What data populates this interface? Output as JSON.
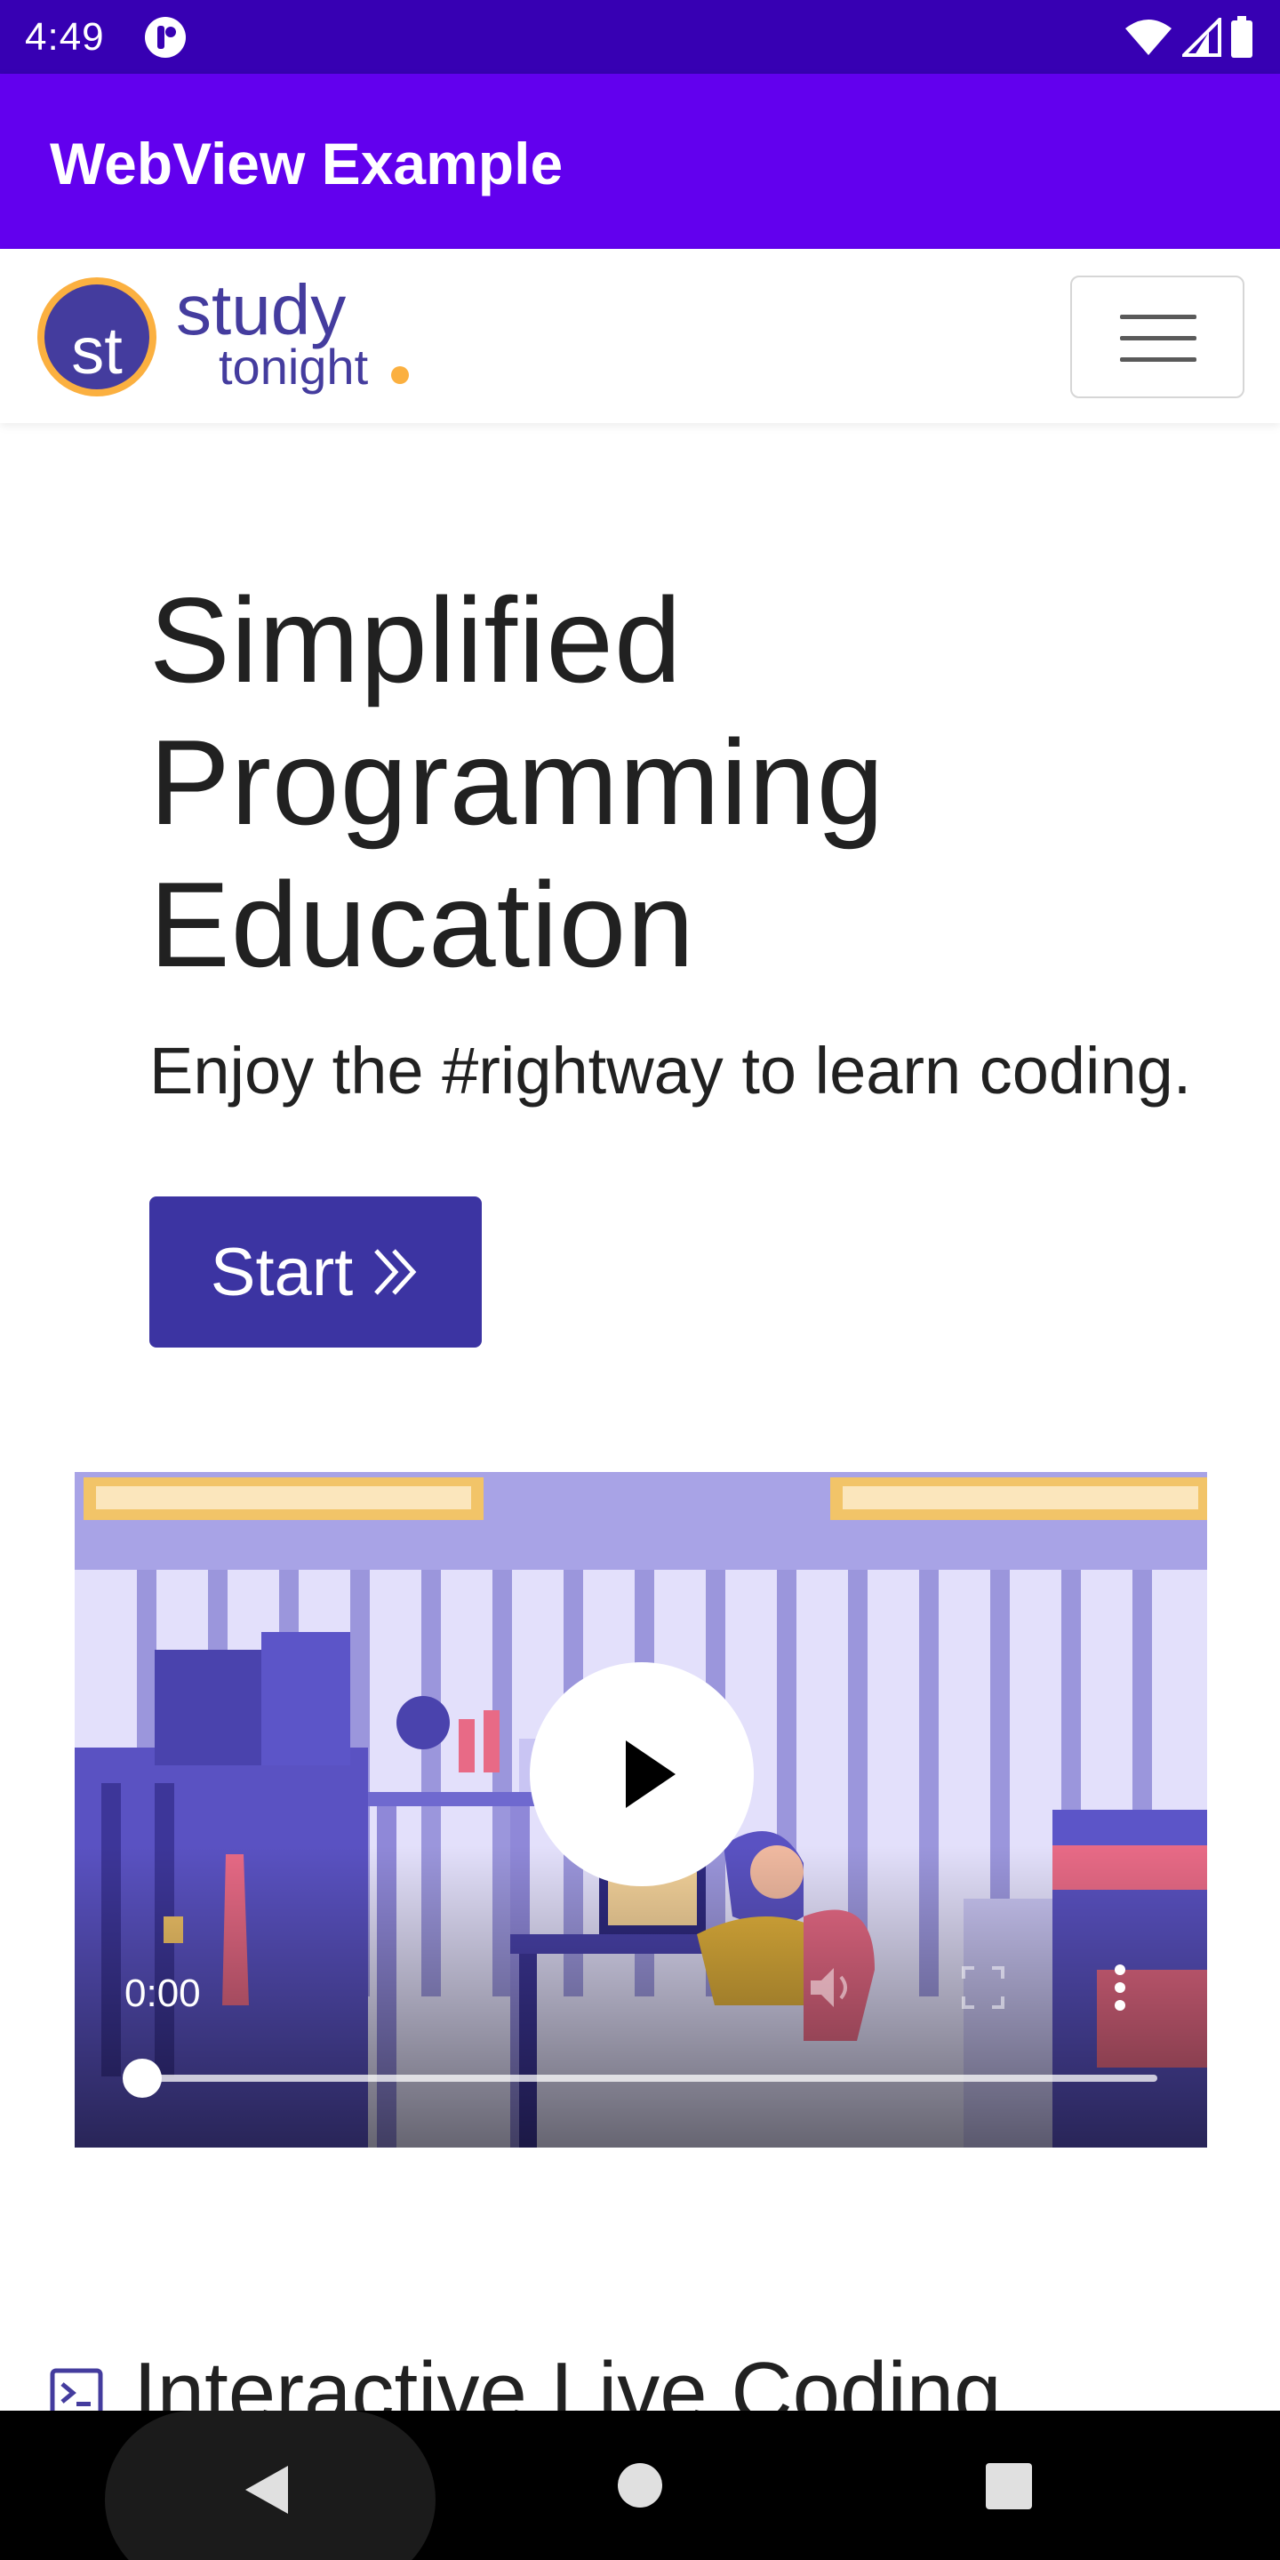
{
  "status_bar": {
    "time": "4:49",
    "icons": [
      "app-notification-icon",
      "wifi-icon",
      "cell-signal-icon",
      "battery-icon"
    ]
  },
  "app_bar": {
    "title": "WebView Example"
  },
  "site_nav": {
    "logo_initials": "st",
    "logo_word_1": "study",
    "logo_word_2": "tonight",
    "menu_icon": "hamburger-menu-icon"
  },
  "hero": {
    "title_lines": [
      "Simplified",
      "Programming",
      "Education"
    ],
    "subtitle": "Enjoy the #rightway to learn coding.",
    "start_label": "Start",
    "start_icon": "double-chevron-right-icon"
  },
  "video": {
    "current_time": "0:00",
    "progress_fraction": 0.0,
    "controls": [
      "play-icon",
      "volume-icon",
      "fullscreen-icon",
      "more-vert-icon"
    ]
  },
  "next_section": {
    "icon": "terminal-icon",
    "title": "Interactive Live Coding"
  },
  "nav_bar": {
    "buttons": [
      "back-icon",
      "home-icon",
      "recents-icon"
    ]
  },
  "colors": {
    "status_bar": "#3700b3",
    "app_bar": "#6200ee",
    "brand_purple": "#443c9e",
    "brand_orange": "#fbb040",
    "start_button": "#3c34a2"
  }
}
